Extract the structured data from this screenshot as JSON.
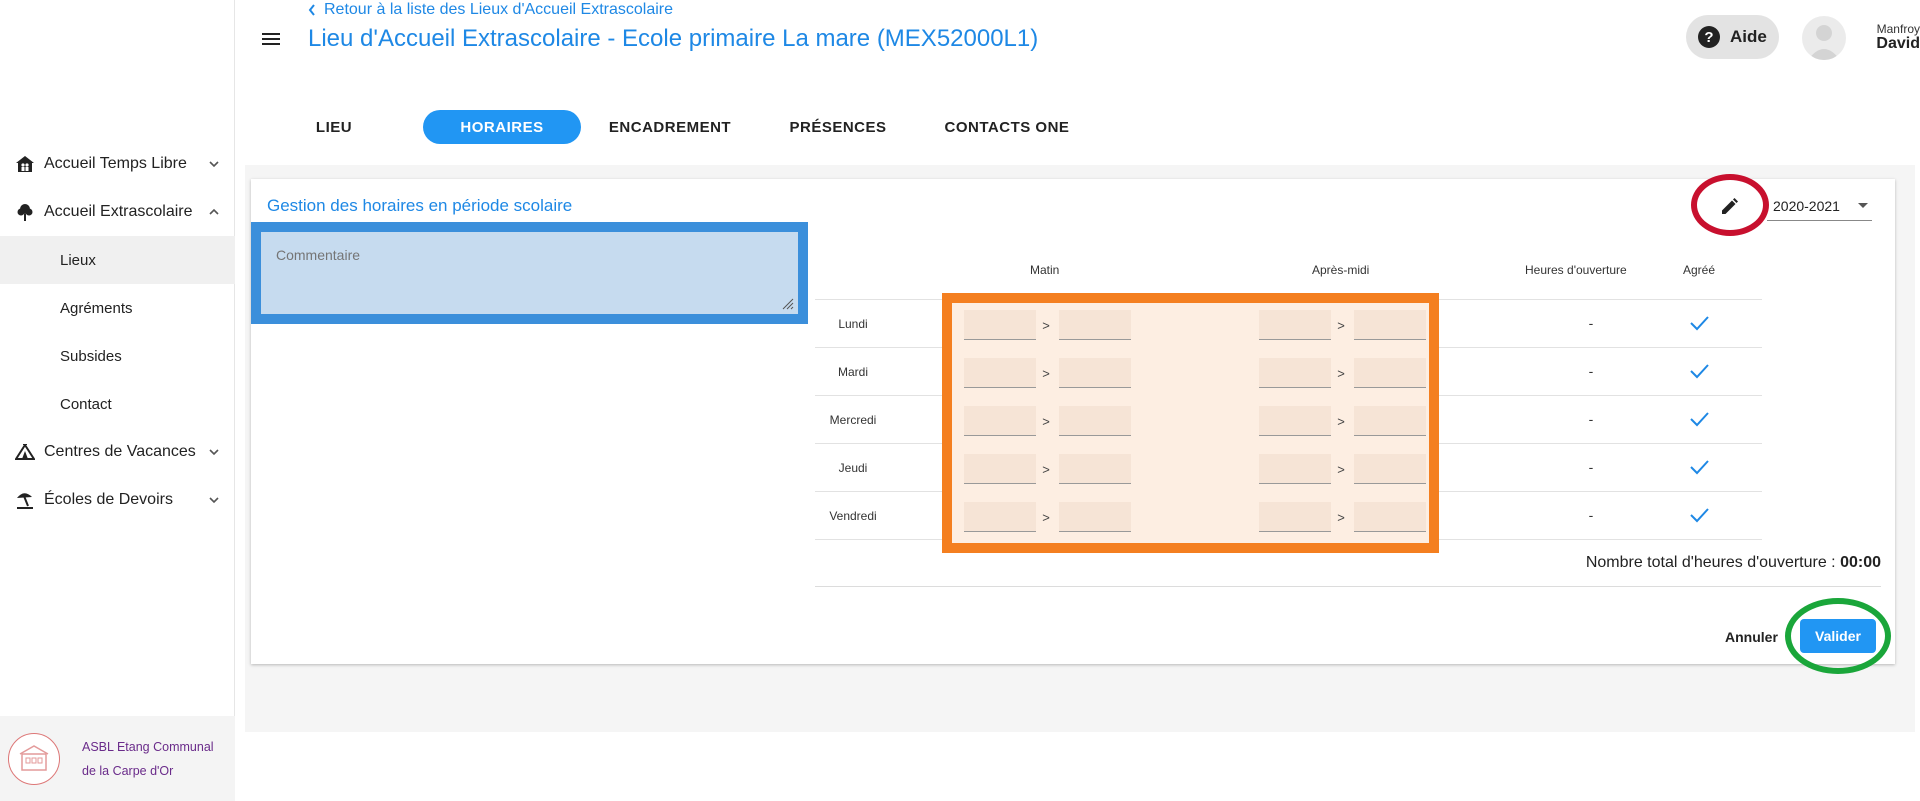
{
  "header": {
    "back_link": "Retour à la liste des Lieux d'Accueil Extrascolaire",
    "title": "Lieu d'Accueil Extrascolaire - Ecole primaire La mare (MEX52000L1)",
    "help_label": "Aide",
    "user_first": "Manfroy",
    "user_last": "David"
  },
  "sidebar": {
    "items": [
      {
        "label": "Accueil Temps Libre",
        "icon": "home-people-icon",
        "expanded": false
      },
      {
        "label": "Accueil Extrascolaire",
        "icon": "tree-icon",
        "expanded": true
      },
      {
        "label": "Centres de Vacances",
        "icon": "tent-icon",
        "expanded": false
      },
      {
        "label": "Écoles de Devoirs",
        "icon": "beach-umbrella-icon",
        "expanded": false
      }
    ],
    "subitems": [
      {
        "label": "Lieux",
        "active": true
      },
      {
        "label": "Agréments",
        "active": false
      },
      {
        "label": "Subsides",
        "active": false
      },
      {
        "label": "Contact",
        "active": false
      }
    ],
    "org_name": "ASBL Etang Communal de la Carpe d'Or"
  },
  "tabs": [
    {
      "label": "LIEU",
      "active": false
    },
    {
      "label": "HORAIRES",
      "active": true
    },
    {
      "label": "ENCADREMENT",
      "active": false
    },
    {
      "label": "PRÉSENCES",
      "active": false
    },
    {
      "label": "CONTACTS ONE",
      "active": false
    }
  ],
  "card": {
    "title": "Gestion des horaires en période scolaire",
    "comment_placeholder": "Commentaire",
    "year": "2020-2021"
  },
  "schedule": {
    "headers": {
      "morning": "Matin",
      "afternoon": "Après-midi",
      "hours": "Heures d'ouverture",
      "approved": "Agréé"
    },
    "rows": [
      {
        "day": "Lundi",
        "hours": "-",
        "approved": true
      },
      {
        "day": "Mardi",
        "hours": "-",
        "approved": true
      },
      {
        "day": "Mercredi",
        "hours": "-",
        "approved": true
      },
      {
        "day": "Jeudi",
        "hours": "-",
        "approved": true
      },
      {
        "day": "Vendredi",
        "hours": "-",
        "approved": true
      }
    ],
    "arrow": ">",
    "total_label": "Nombre total d'heures d'ouverture :",
    "total_value": "00:00"
  },
  "actions": {
    "cancel": "Annuler",
    "validate": "Valider"
  },
  "colors": {
    "accent": "#1e88e5",
    "primary_button": "#2196f3",
    "highlight_comment": "#3b8fdb",
    "highlight_times": "#f47f20",
    "ring_edit": "#c8102e",
    "ring_validate": "#1aa63a"
  }
}
